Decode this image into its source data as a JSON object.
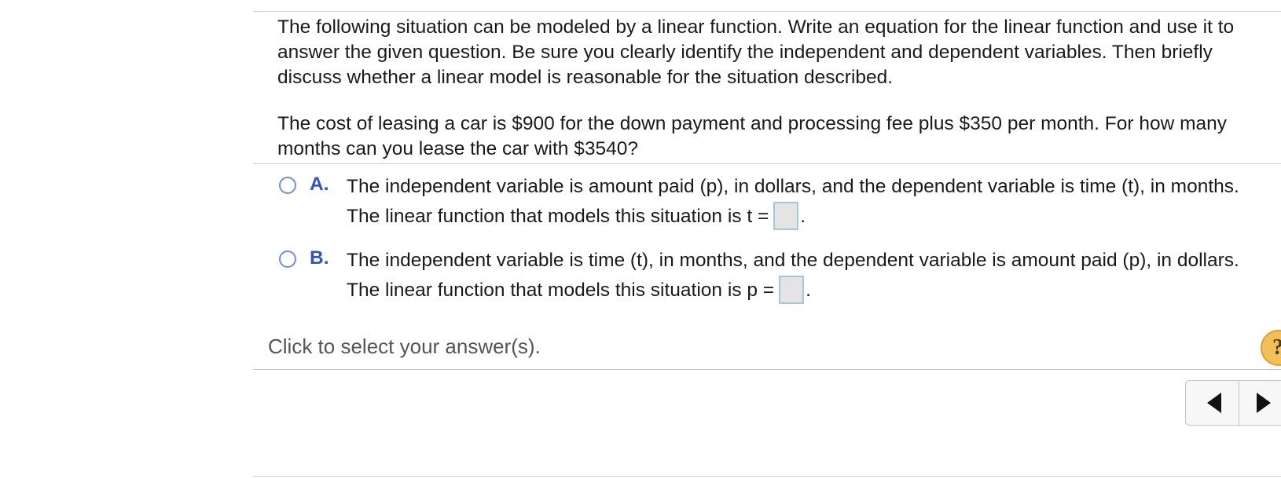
{
  "question": {
    "instructions": "The following situation can be modeled by a linear function. Write an equation for the linear function and use it to answer the given question. Be sure you clearly identify the independent and dependent variables. Then briefly discuss whether a linear model is reasonable for the situation described.",
    "problem": "The cost of leasing a car is $900 for the down payment and processing fee plus $350 per month. For how many months can you lease the car with $3540?"
  },
  "choices": [
    {
      "letter": "A.",
      "text": "The independent variable is amount paid (p), in dollars, and the dependent variable is time (t), in months. The linear function that models this situation is",
      "equation_label": "t =",
      "answer_value": "",
      "selected": false
    },
    {
      "letter": "B.",
      "text": "The independent variable is time (t), in months, and the dependent variable is amount paid (p), in dollars. The linear function that models this situation is",
      "equation_label": "p =",
      "answer_value": "",
      "selected": false
    }
  ],
  "status_text": "Click to select your answer(s).",
  "help_label": "?",
  "punctuation": {
    "period": "."
  },
  "icons": {
    "help": "help-icon",
    "prev": "arrow-left-icon",
    "next": "arrow-right-icon"
  },
  "colors": {
    "accent_letter": "#2f55c4",
    "radio_border": "#6f8ed9",
    "answer_box_fill": "#e4e4e4",
    "answer_box_border": "#9fcad6",
    "help_button": "#f2c058"
  }
}
